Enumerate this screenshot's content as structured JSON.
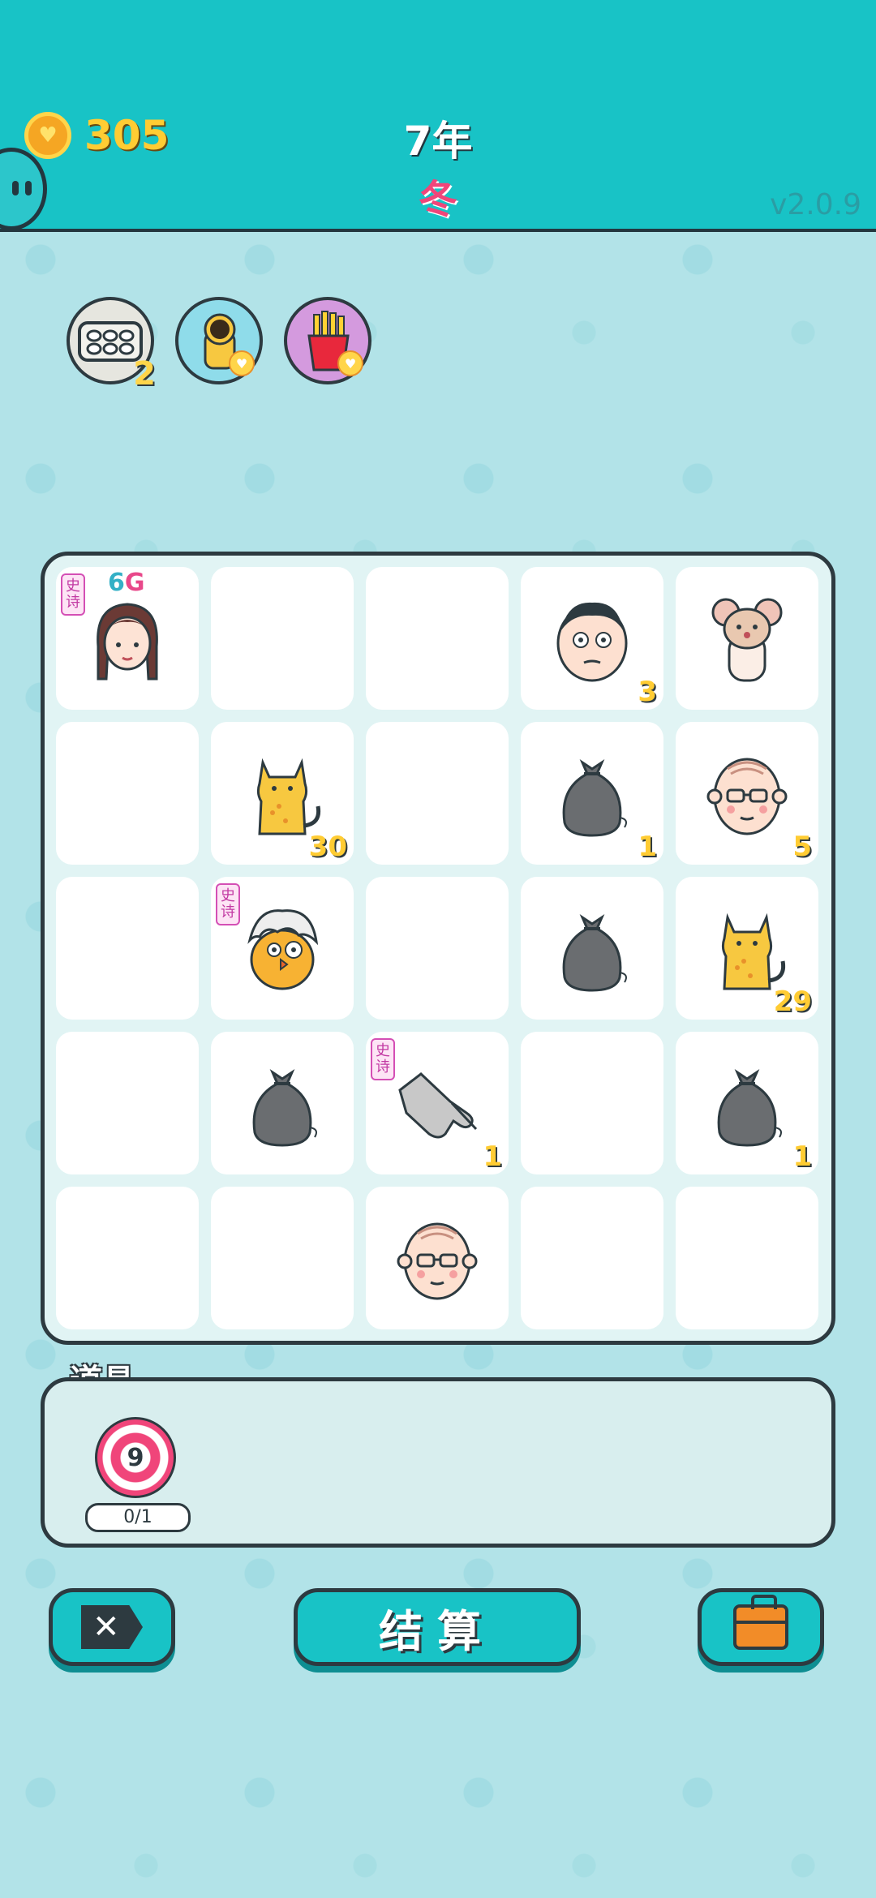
{
  "header": {
    "coins": "305",
    "year": "7年",
    "season": "冬",
    "version": "v2.0.9"
  },
  "buffs": [
    {
      "icon": "egg-carton-icon",
      "count": "2"
    },
    {
      "icon": "cat-eating-icon"
    },
    {
      "icon": "fries-icon"
    }
  ],
  "board": {
    "cells": [
      {
        "row": 0,
        "col": 0,
        "item": "girl",
        "tag": "史诗",
        "level": "6",
        "level_unit": "G"
      },
      {
        "row": 0,
        "col": 1,
        "item": ""
      },
      {
        "row": 0,
        "col": 2,
        "item": ""
      },
      {
        "row": 0,
        "col": 3,
        "item": "man",
        "count": "3"
      },
      {
        "row": 0,
        "col": 4,
        "item": "mouse"
      },
      {
        "row": 1,
        "col": 0,
        "item": ""
      },
      {
        "row": 1,
        "col": 1,
        "item": "cat",
        "count": "30"
      },
      {
        "row": 1,
        "col": 2,
        "item": ""
      },
      {
        "row": 1,
        "col": 3,
        "item": "trash-bag",
        "count": "1"
      },
      {
        "row": 1,
        "col": 4,
        "item": "old-man",
        "count": "5"
      },
      {
        "row": 2,
        "col": 0,
        "item": ""
      },
      {
        "row": 2,
        "col": 1,
        "item": "bird",
        "tag": "史诗"
      },
      {
        "row": 2,
        "col": 2,
        "item": ""
      },
      {
        "row": 2,
        "col": 3,
        "item": "trash-bag"
      },
      {
        "row": 2,
        "col": 4,
        "item": "cat",
        "count": "29"
      },
      {
        "row": 3,
        "col": 0,
        "item": ""
      },
      {
        "row": 3,
        "col": 1,
        "item": "trash-bag"
      },
      {
        "row": 3,
        "col": 2,
        "item": "pointing-hand",
        "tag": "史诗",
        "count": "1"
      },
      {
        "row": 3,
        "col": 3,
        "item": ""
      },
      {
        "row": 3,
        "col": 4,
        "item": "trash-bag",
        "count": "1"
      },
      {
        "row": 4,
        "col": 0,
        "item": ""
      },
      {
        "row": 4,
        "col": 1,
        "item": ""
      },
      {
        "row": 4,
        "col": 2,
        "item": "old-man"
      },
      {
        "row": 4,
        "col": 3,
        "item": ""
      },
      {
        "row": 4,
        "col": 4,
        "item": ""
      }
    ]
  },
  "items_panel": {
    "title": "道具",
    "target_number": "9",
    "target_count": "0/1"
  },
  "buttons": {
    "settle_label": "结算",
    "close_label": "✕"
  }
}
